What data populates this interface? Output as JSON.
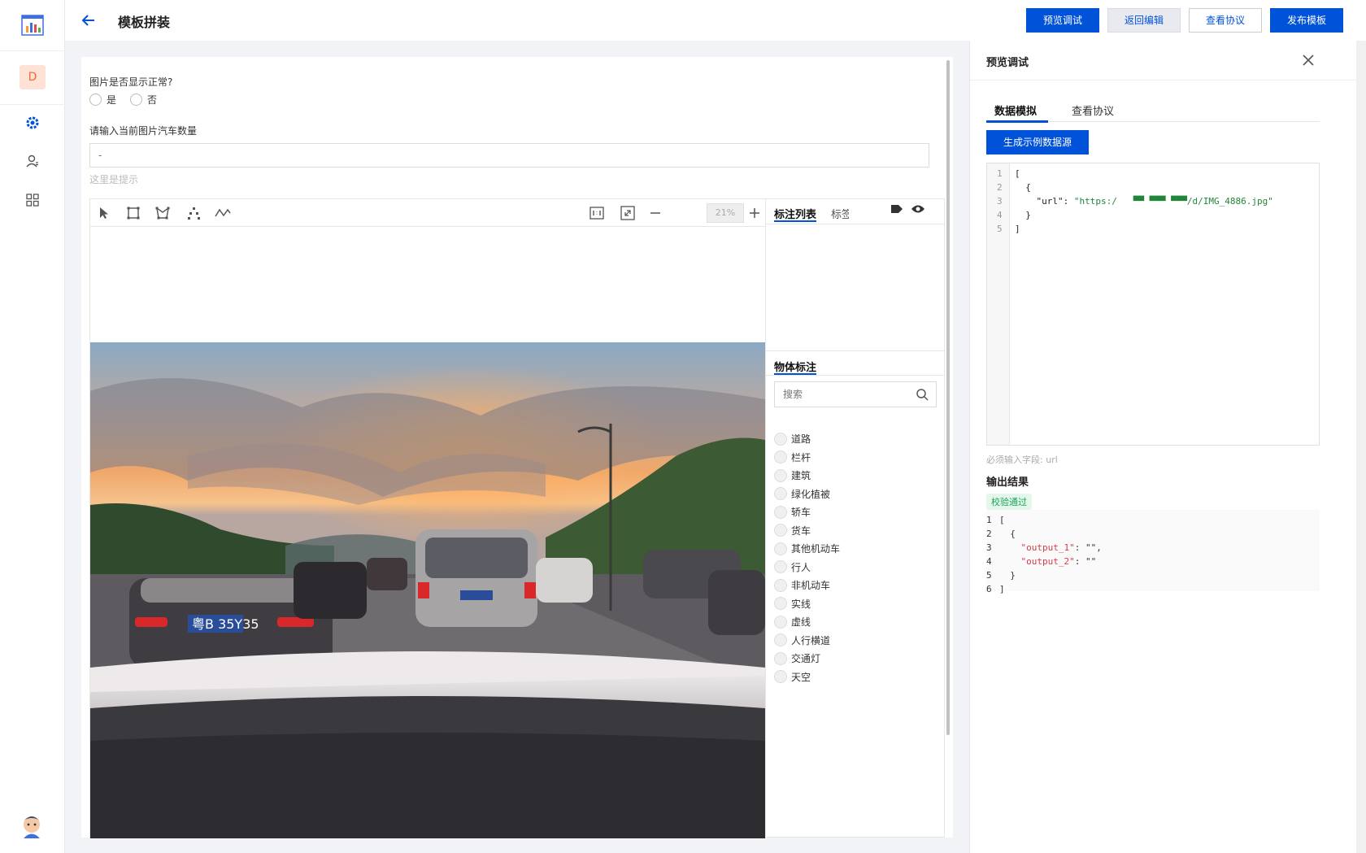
{
  "header": {
    "title": "模板拼装",
    "buttons": {
      "preview": "预览调试",
      "back_edit": "返回编辑",
      "view_protocol": "查看协议",
      "publish": "发布模板"
    }
  },
  "rail": {
    "avatar_letter": "D"
  },
  "form": {
    "question1": "图片是否显示正常?",
    "options": [
      "是",
      "否"
    ],
    "question2": "请输入当前图片汽车数量",
    "count_placeholder": "-",
    "hint": "这里是提示"
  },
  "toolbar": {
    "zoom": "21%"
  },
  "side_panel": {
    "tabs": [
      "标注列表",
      "标签"
    ],
    "section_title": "物体标注",
    "search_placeholder": "搜索",
    "labels": [
      "道路",
      "栏杆",
      "建筑",
      "绿化植被",
      "轿车",
      "货车",
      "其他机动车",
      "行人",
      "非机动车",
      "实线",
      "虚线",
      "人行横道",
      "交通灯",
      "天空"
    ]
  },
  "drawer": {
    "title": "预览调试",
    "tabs": [
      "数据模拟",
      "查看协议"
    ],
    "generate_button": "生成示例数据源",
    "editor_lines": [
      "1",
      "2",
      "3",
      "4",
      "5"
    ],
    "editor_code": {
      "l1": "[",
      "l2": "  {",
      "l3_key": "    \"url\": ",
      "l3_val": "\"https:/   ▀▀ ▀▀▀ ▀▀▀/d/IMG_4886.jpg\"",
      "l4": "  }",
      "l5": "]"
    },
    "required_fields": "必须输入字段: url",
    "output_title": "输出结果",
    "badge": "校验通过",
    "output_lines": [
      "1",
      "2",
      "3",
      "4",
      "5",
      "6"
    ],
    "output_code": {
      "l1": "[",
      "l2": "  {",
      "l3_key": "    \"output_1\"",
      "l3_rest": ": \"\",",
      "l4_key": "    \"output_2\"",
      "l4_rest": ": \"\"",
      "l5": "  }",
      "l6": "]"
    }
  }
}
